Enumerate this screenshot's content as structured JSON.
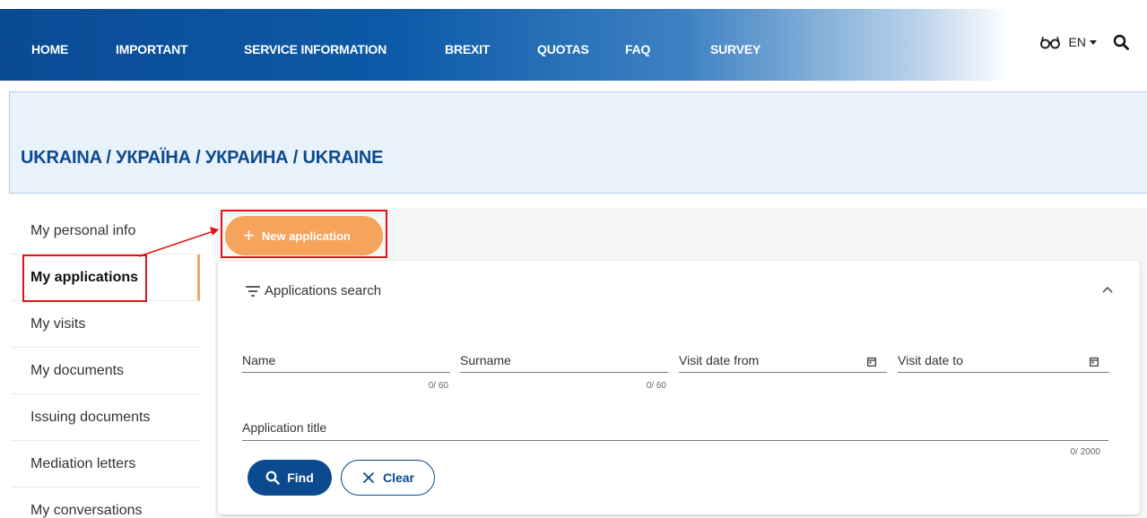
{
  "nav": {
    "items": [
      "HOME",
      "IMPORTANT",
      "SERVICE INFORMATION",
      "BREXIT",
      "QUOTAS",
      "FAQ",
      "SURVEY"
    ],
    "lang": "EN",
    "icons": [
      "glasses-icon",
      "chevron-down-icon",
      "search-icon"
    ]
  },
  "banner": {
    "title": "UKRAINA / УКРАЇНА / УКРАИНА / UKRAINE"
  },
  "sidebar": {
    "items": [
      {
        "label": "My personal info"
      },
      {
        "label": "My applications"
      },
      {
        "label": "My visits"
      },
      {
        "label": "My documents"
      },
      {
        "label": "Issuing documents"
      },
      {
        "label": "Mediation letters"
      },
      {
        "label": "My conversations"
      }
    ],
    "active": "My applications"
  },
  "main": {
    "new_application_label": "New application",
    "search": {
      "title": "Applications search",
      "fields": {
        "name": {
          "label": "Name",
          "counter": "0/ 60"
        },
        "surname": {
          "label": "Surname",
          "counter": "0/ 60"
        },
        "visit_from": {
          "label": "Visit date from"
        },
        "visit_to": {
          "label": "Visit date to"
        },
        "app_title": {
          "label": "Application title",
          "counter": "0/ 2000"
        }
      },
      "find_label": "Find",
      "clear_label": "Clear"
    }
  },
  "colors": {
    "primary": "#0b4a8f",
    "accent": "#f6a35c",
    "highlight": "#e0141a"
  }
}
